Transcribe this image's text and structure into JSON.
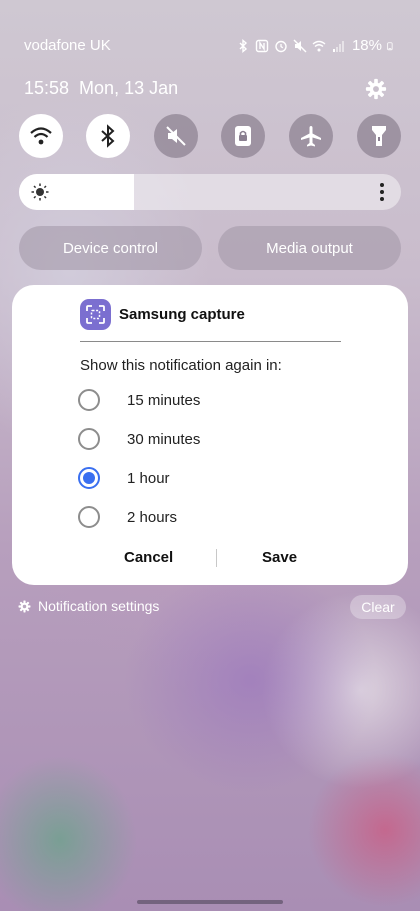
{
  "status_bar": {
    "carrier": "vodafone UK",
    "battery": "18%",
    "icons": [
      "bluetooth-icon",
      "nfc-icon",
      "alarm-icon",
      "mute-icon",
      "wifi-icon",
      "signal-icon",
      "battery-icon"
    ]
  },
  "header": {
    "time": "15:58",
    "date": "Mon, 13 Jan",
    "settings_icon": "gear-icon"
  },
  "quick_tiles": [
    {
      "name": "wifi",
      "icon": "wifi-icon",
      "active": true
    },
    {
      "name": "bluetooth",
      "icon": "bluetooth-icon",
      "active": true
    },
    {
      "name": "sound",
      "icon": "mute-icon",
      "active": false
    },
    {
      "name": "rotation-lock",
      "icon": "lock-rotation-icon",
      "active": false
    },
    {
      "name": "airplane",
      "icon": "airplane-icon",
      "active": false
    },
    {
      "name": "torch",
      "icon": "flashlight-icon",
      "active": false
    }
  ],
  "brightness": {
    "level_percent": 30
  },
  "actions": {
    "device_control": "Device control",
    "media_output": "Media output"
  },
  "notification": {
    "app_name": "Samsung capture",
    "prompt": "Show this notification again in:",
    "options": [
      {
        "label": "15 minutes",
        "selected": false
      },
      {
        "label": "30 minutes",
        "selected": false
      },
      {
        "label": "1 hour",
        "selected": true
      },
      {
        "label": "2 hours",
        "selected": false
      }
    ],
    "cancel": "Cancel",
    "save": "Save"
  },
  "footer": {
    "notification_settings": "Notification settings",
    "clear": "Clear"
  },
  "colors": {
    "accent": "#3a6ff0",
    "app_icon": "#7b6fd0"
  }
}
